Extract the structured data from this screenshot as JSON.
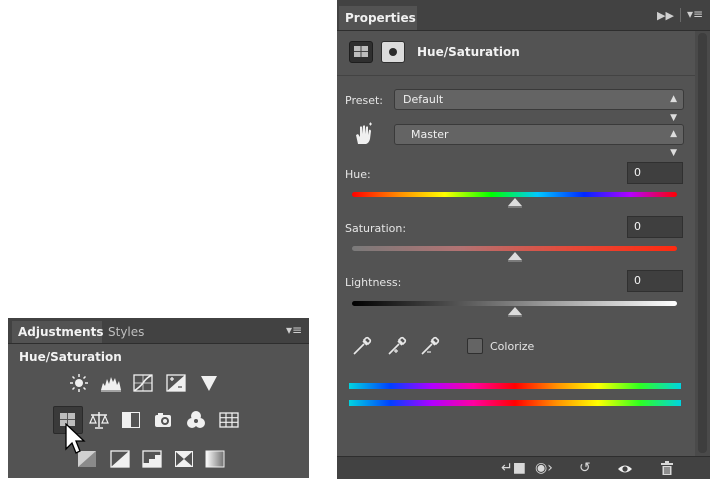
{
  "properties_panel": {
    "tab_label": "Properties",
    "header_title": "Hue/Saturation",
    "preset_label": "Preset:",
    "preset_value": "Default",
    "channel_value": "Master",
    "hue": {
      "label": "Hue:",
      "value": "0",
      "position": 0.5
    },
    "saturation": {
      "label": "Saturation:",
      "value": "0",
      "position": 0.5
    },
    "lightness": {
      "label": "Lightness:",
      "value": "0",
      "position": 0.5
    },
    "colorize_label": "Colorize",
    "colorize_checked": false,
    "footer_icons": [
      "clip-to-layer-icon",
      "view-previous-state-icon",
      "reset-icon",
      "visibility-icon",
      "delete-icon"
    ]
  },
  "adjustments_panel": {
    "tabs": [
      "Adjustments",
      "Styles"
    ],
    "active_tab": "Adjustments",
    "title": "Hue/Saturation",
    "row1_icons": [
      "brightness-contrast-icon",
      "levels-icon",
      "curves-icon",
      "exposure-icon",
      "vibrance-icon"
    ],
    "row2_icons": [
      "hue-saturation-icon",
      "color-balance-icon",
      "black-white-icon",
      "photo-filter-icon",
      "channel-mixer-icon",
      "color-lookup-icon"
    ],
    "row3_icons": [
      "invert-icon",
      "posterize-icon",
      "threshold-icon",
      "selective-color-icon",
      "gradient-map-icon"
    ]
  },
  "colors": {
    "panel_bg": "#535353",
    "tab_bar_bg": "#424242",
    "field_bg": "#3f3f3f"
  }
}
